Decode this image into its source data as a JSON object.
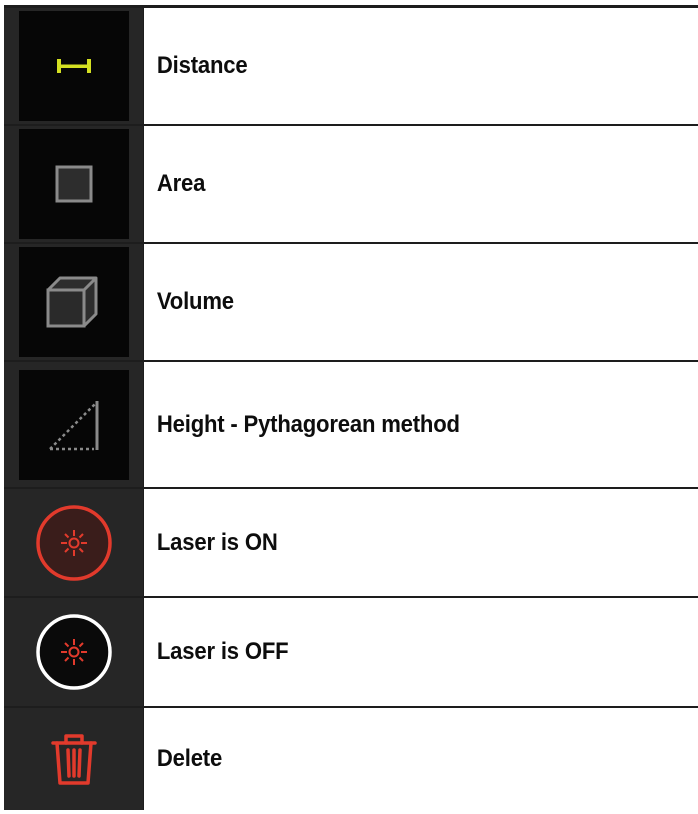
{
  "legend": {
    "items": [
      {
        "label": "Distance",
        "icon": "distance-icon"
      },
      {
        "label": "Area",
        "icon": "area-icon"
      },
      {
        "label": "Volume",
        "icon": "volume-icon"
      },
      {
        "label": "Height - Pythagorean method",
        "icon": "height-pythagorean-icon"
      },
      {
        "label": "Laser is ON",
        "icon": "laser-on-icon"
      },
      {
        "label": "Laser is OFF",
        "icon": "laser-off-icon"
      },
      {
        "label": "Delete",
        "icon": "trash-icon"
      }
    ]
  },
  "colors": {
    "distance_icon": "#d4e022",
    "laser_red": "#e23a2c",
    "icon_gray": "#8a8a8a",
    "row_background": "#262626"
  }
}
